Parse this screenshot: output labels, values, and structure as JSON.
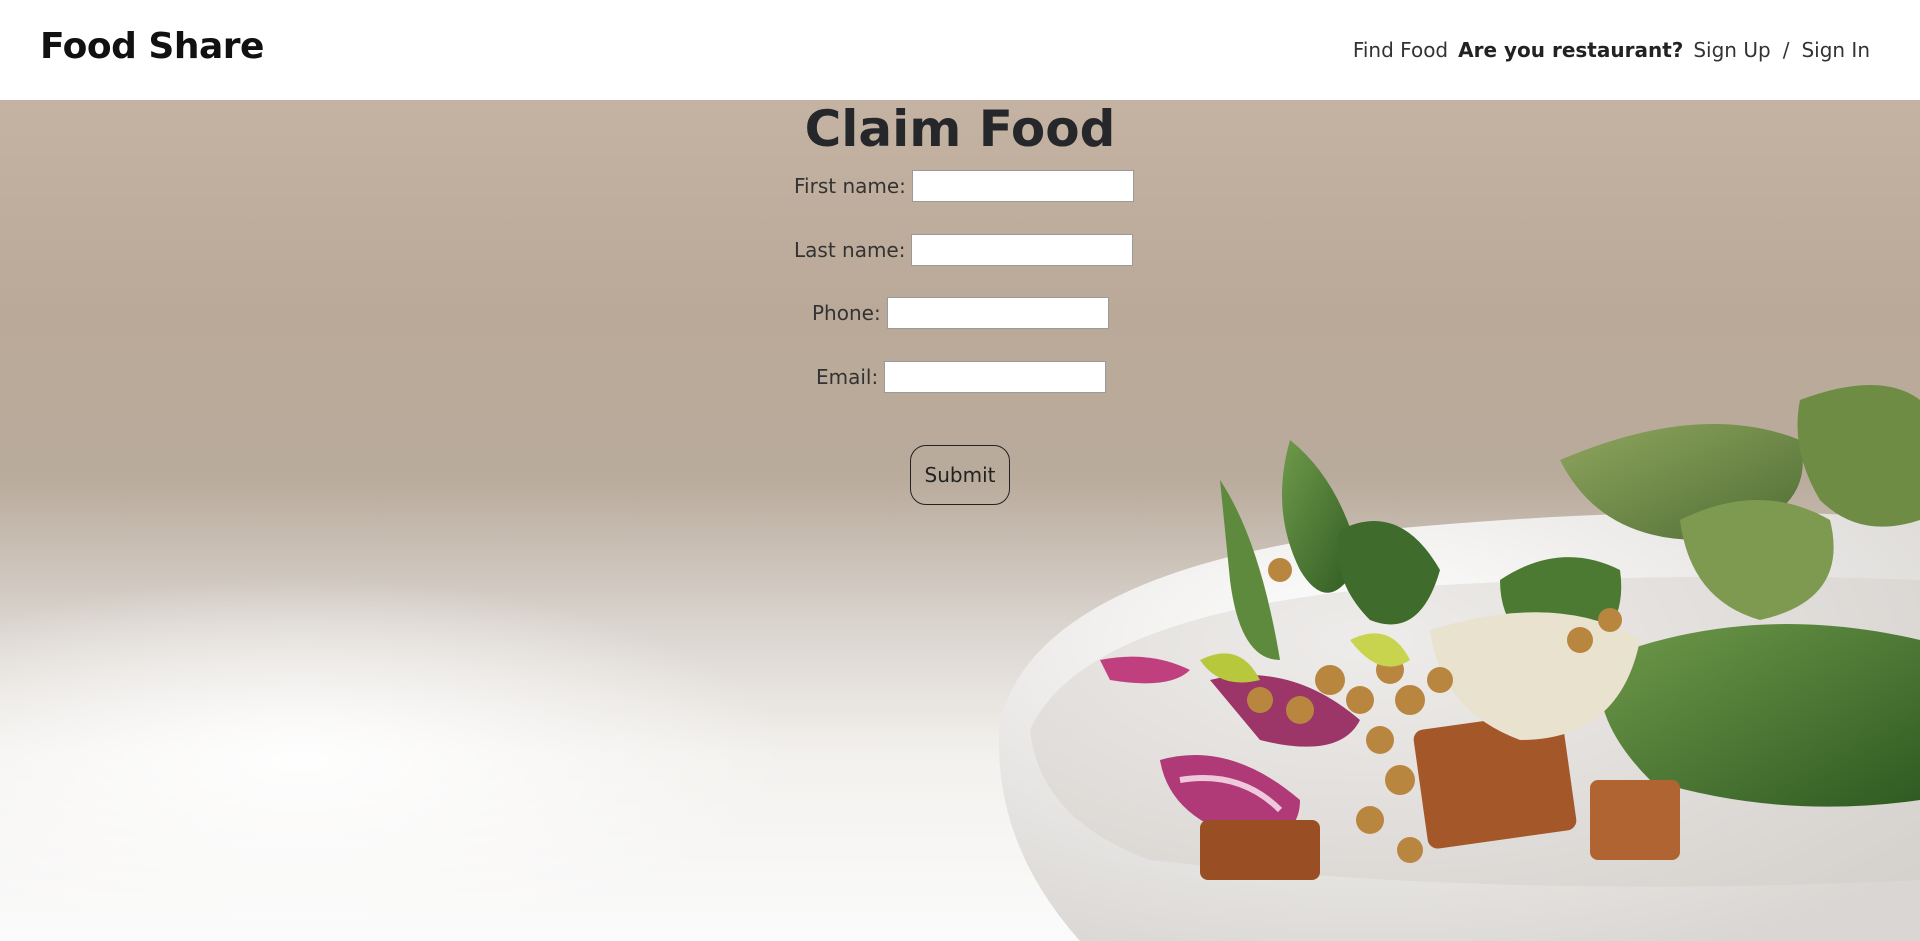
{
  "navbar": {
    "brand": "Food Share",
    "links": {
      "find_food": "Find Food",
      "restaurant_prompt": "Are you restaurant?",
      "sign_up": "Sign Up",
      "separator": "/",
      "sign_in": "Sign In"
    }
  },
  "form": {
    "title": "Claim Food",
    "fields": {
      "first_name": {
        "label": "First name:",
        "value": "",
        "placeholder": ""
      },
      "last_name": {
        "label": "Last name:",
        "value": "",
        "placeholder": ""
      },
      "phone": {
        "label": "Phone:",
        "value": "",
        "placeholder": ""
      },
      "email": {
        "label": "Email:",
        "value": "",
        "placeholder": ""
      }
    },
    "submit_label": "Submit"
  },
  "colors": {
    "navbar_bg": "#ffffff",
    "hero_top": "#c4b3a2",
    "hero_bottom": "#fbfbfb",
    "title_text": "#26272b"
  }
}
